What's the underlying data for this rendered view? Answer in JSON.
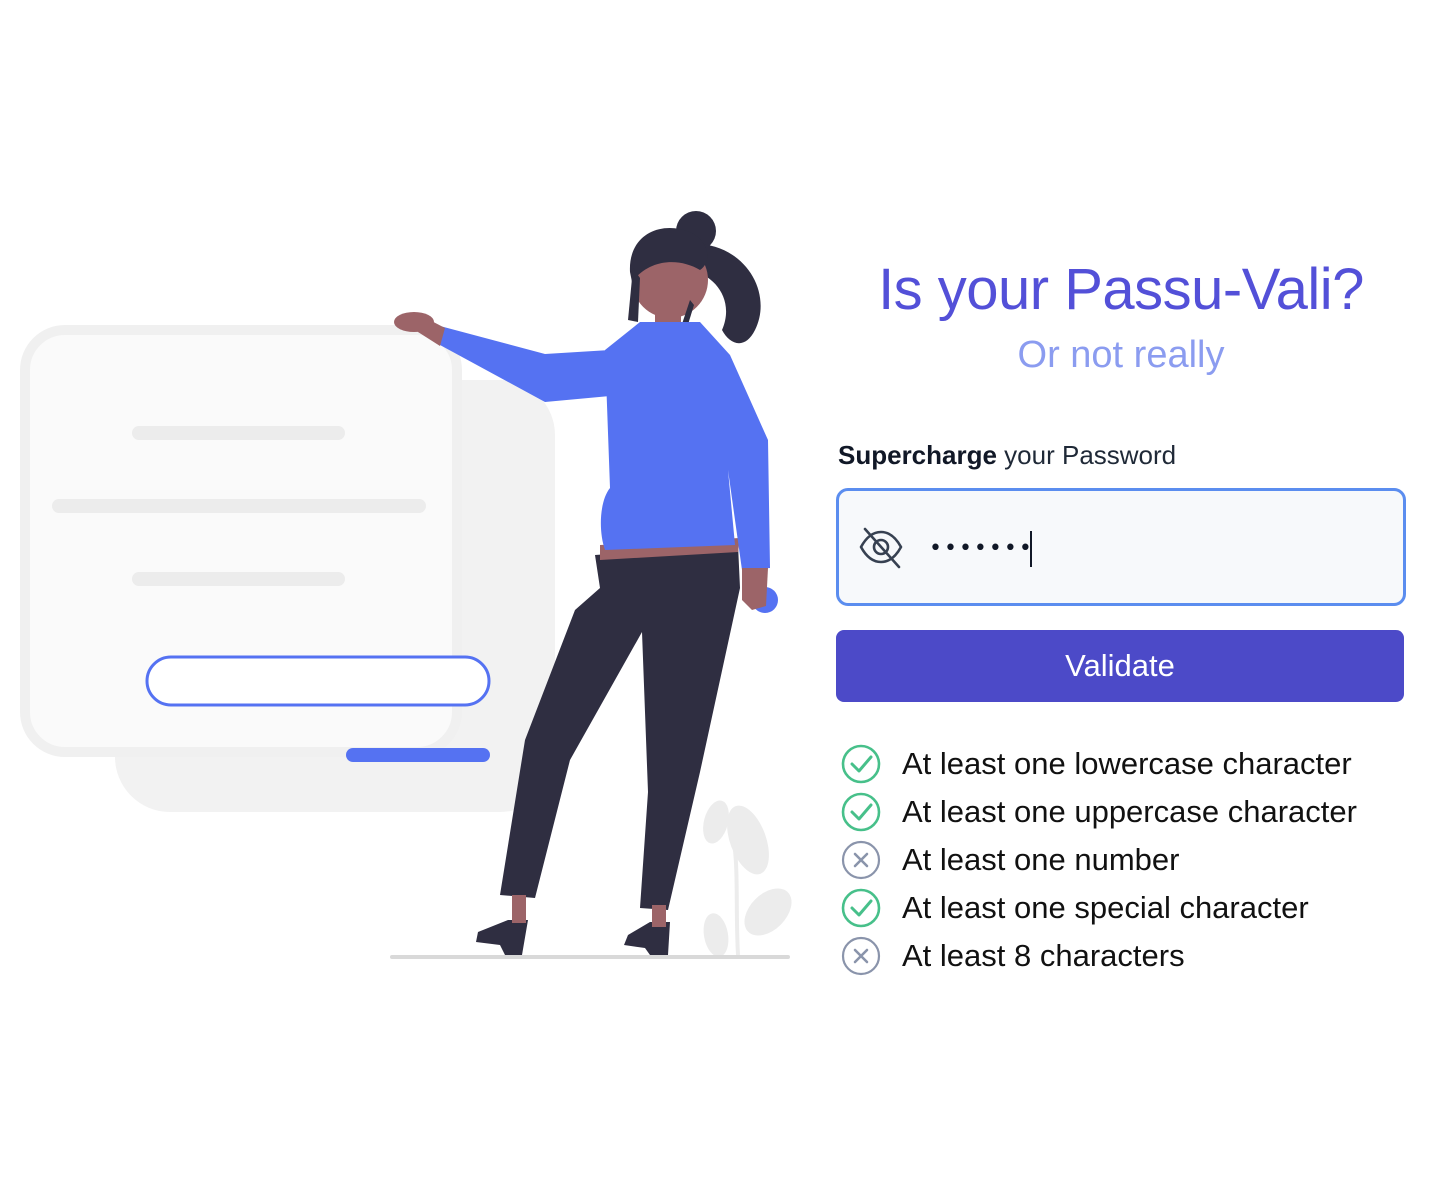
{
  "colors": {
    "accent": "#5350d8",
    "accent_soft": "#8b9cf0",
    "button": "#4c4ac8",
    "input_border": "#5b8def",
    "pass": "#47c08a",
    "fail": "#8a94ab",
    "figure_shirt": "#5572f2",
    "figure_pants": "#2f2e41",
    "figure_skin": "#9c6468"
  },
  "header": {
    "title": "Is your Passu-Vali?",
    "subtitle": "Or not really"
  },
  "form": {
    "label_bold": "Supercharge",
    "label_rest": " your Password",
    "password_value": "•••••••",
    "visibility_icon": "eye-off-icon",
    "validate_label": "Validate"
  },
  "rules": [
    {
      "text": "At least one lowercase character",
      "passed": true,
      "icon": "check-circle-icon"
    },
    {
      "text": "At least one uppercase character",
      "passed": true,
      "icon": "check-circle-icon"
    },
    {
      "text": "At least one number",
      "passed": false,
      "icon": "x-circle-icon"
    },
    {
      "text": "At least one special character",
      "passed": true,
      "icon": "check-circle-icon"
    },
    {
      "text": "At least 8 characters",
      "passed": false,
      "icon": "x-circle-icon"
    }
  ]
}
